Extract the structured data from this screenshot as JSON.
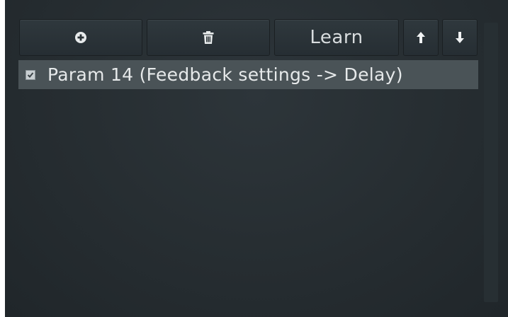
{
  "toolbar": {
    "add_icon": "plus-circle-icon",
    "delete_icon": "trash-icon",
    "learn_label": "Learn",
    "up_icon": "arrow-up-icon",
    "down_icon": "arrow-down-icon"
  },
  "list": {
    "items": [
      {
        "label": "Param 14 (Feedback settings -> Delay)",
        "checked": true
      }
    ]
  },
  "colors": {
    "background": "#262d31",
    "button": "#2b3439",
    "selected_row": "#4a5357",
    "text": "#e6e9ea"
  }
}
